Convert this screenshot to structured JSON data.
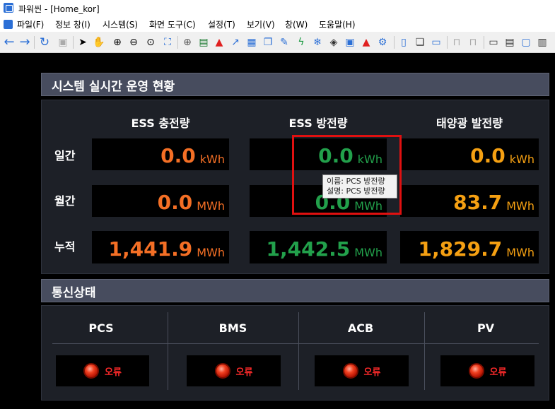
{
  "window": {
    "title": "파워씬 - [Home_kor]"
  },
  "menu": [
    "파일(F)",
    "정보 창(I)",
    "시스템(S)",
    "화면 도구(C)",
    "설정(T)",
    "보기(V)",
    "창(W)",
    "도움말(H)"
  ],
  "toolbar_icons": [
    "back-icon",
    "forward-icon",
    "refresh-icon",
    "save-icon",
    "pointer-icon",
    "hand-icon",
    "zoom-in-icon",
    "zoom-out-icon",
    "zoom-area-icon",
    "fit-icon",
    "globe-icon",
    "list-icon",
    "alarm-icon",
    "trend-icon",
    "report-icon",
    "document-icon",
    "edit-icon",
    "energy-icon",
    "snowflake-icon",
    "layers-icon",
    "window-icon",
    "bell-icon",
    "gear-icon",
    "panel-icon",
    "cascade-icon",
    "monitor-icon",
    "lock-icon",
    "unlock-icon",
    "display-icon",
    "text-icon",
    "comment-icon"
  ],
  "operation": {
    "title": "시스템 실시간 운영 현황",
    "columns": [
      "ESS 충전량",
      "ESS 방전량",
      "태양광 발전량"
    ],
    "rows": [
      {
        "label": "일간",
        "values": [
          {
            "num": "0.0",
            "unit": "kWh"
          },
          {
            "num": "0.0",
            "unit": "kWh"
          },
          {
            "num": "0.0",
            "unit": "kWh"
          }
        ]
      },
      {
        "label": "월간",
        "values": [
          {
            "num": "0.0",
            "unit": "MWh"
          },
          {
            "num": "0.0",
            "unit": "MWh"
          },
          {
            "num": "83.7",
            "unit": "MWh"
          }
        ]
      },
      {
        "label": "누적",
        "values": [
          {
            "num": "1,441.9",
            "unit": "MWh"
          },
          {
            "num": "1,442.5",
            "unit": "MWh"
          },
          {
            "num": "1,829.7",
            "unit": "MWh"
          }
        ]
      }
    ],
    "colors": {
      "charge": "#f46f25",
      "discharge": "#22a04b",
      "solar": "#f5a012"
    }
  },
  "tooltip": {
    "name_line": "이름: PCS 방전량",
    "desc_line": "설명: PCS 방전량"
  },
  "comm": {
    "title": "통신상태",
    "items": [
      {
        "label": "PCS",
        "status": "오류"
      },
      {
        "label": "BMS",
        "status": "오류"
      },
      {
        "label": "ACB",
        "status": "오류"
      },
      {
        "label": "PV",
        "status": "오류"
      }
    ]
  }
}
